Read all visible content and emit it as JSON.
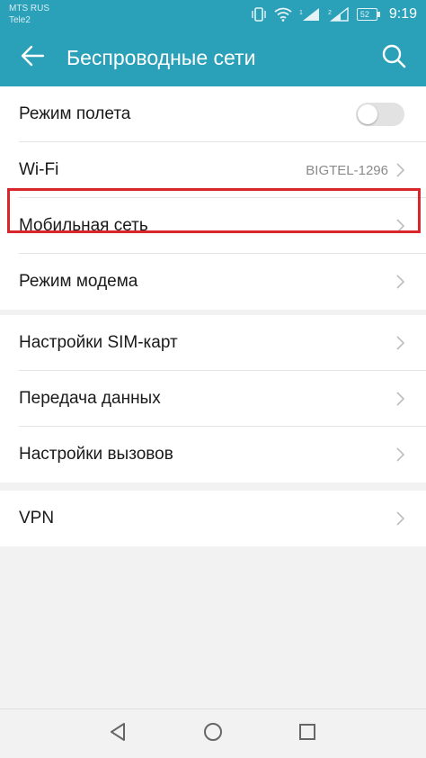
{
  "status_bar": {
    "carrier_1": "MTS RUS",
    "carrier_2": "Tele2",
    "time": "9:19",
    "battery_level": "52",
    "icons": [
      "vibrate-icon",
      "wifi-icon",
      "signal-sim1-icon",
      "signal-sim2-icon",
      "battery-icon"
    ]
  },
  "app_bar": {
    "title": "Беспроводные сети",
    "back_icon": "arrow-left-icon",
    "search_icon": "search-icon",
    "background_color": "#2aa0b9"
  },
  "settings": {
    "group_1": [
      {
        "label": "Режим полета",
        "control": "toggle",
        "toggle_on": false
      },
      {
        "label": "Wi-Fi",
        "value": "BIGTEL-1296",
        "control": "chevron"
      },
      {
        "label": "Мобильная сеть",
        "control": "chevron",
        "highlighted": true
      },
      {
        "label": "Режим модема",
        "control": "chevron"
      }
    ],
    "group_2": [
      {
        "label": "Настройки SIM-карт",
        "control": "chevron"
      },
      {
        "label": "Передача данных",
        "control": "chevron"
      },
      {
        "label": "Настройки вызовов",
        "control": "chevron"
      }
    ],
    "group_3": [
      {
        "label": "VPN",
        "control": "chevron"
      }
    ]
  },
  "highlight_color": "#d8262c",
  "nav_bar": {
    "icons": [
      "back-triangle-icon",
      "home-circle-icon",
      "recents-square-icon"
    ]
  }
}
